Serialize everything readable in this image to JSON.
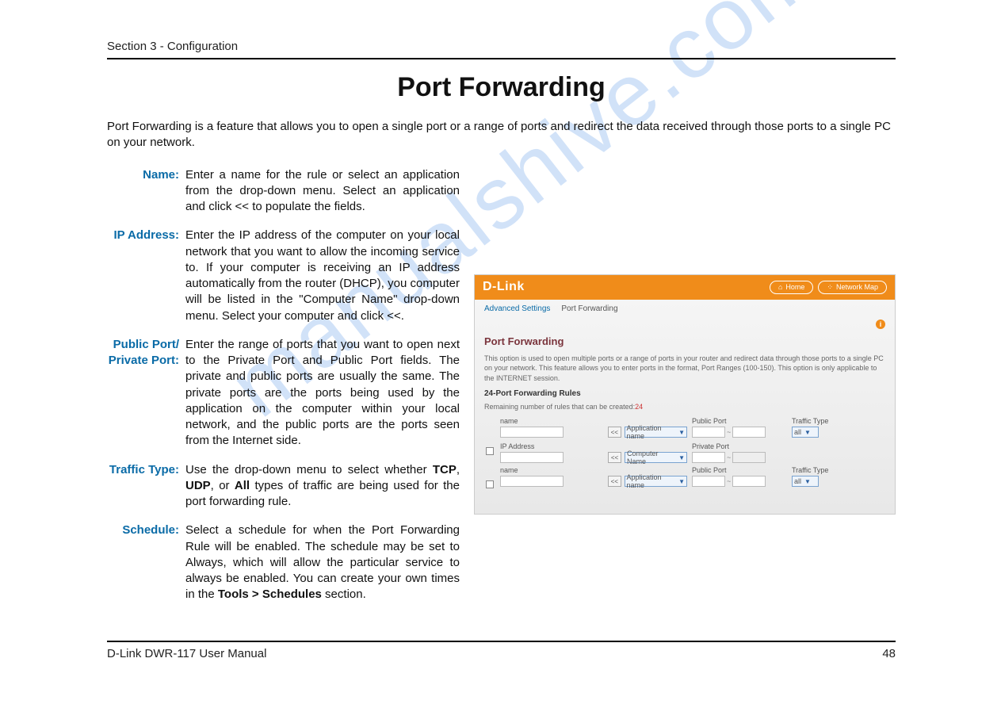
{
  "watermark": "manualshive.com",
  "header": {
    "section_label": "Section 3 - Configuration"
  },
  "title": "Port Forwarding",
  "intro": "Port Forwarding is a feature that allows you to open a single port or a range of ports and redirect the data received through those ports to a single PC on your network.",
  "definitions": [
    {
      "label": "Name:",
      "desc": "Enter a name for the rule or select an application from the drop-down menu. Select an application and click << to populate the fields."
    },
    {
      "label": "IP Address:",
      "desc": "Enter the IP address of the computer on your local network that you want to allow the incoming service to. If your computer is receiving an IP address automatically from the router (DHCP), you computer will be listed in the \"Computer Name\" drop-down menu. Select your computer and click <<."
    },
    {
      "label": "Public Port/",
      "label2": "Private Port:",
      "desc": "Enter the range of ports that you want to open next to the Private Port and Public Port fields. The private and public ports are usually the same. The private ports are the ports being used by the application on the computer within your local network, and the public ports are the ports seen from the Internet side."
    },
    {
      "label": "Traffic Type:",
      "desc_pre": "Use the drop-down menu to select whether ",
      "desc_bold1": "TCP",
      "desc_mid1": ", ",
      "desc_bold2": "UDP",
      "desc_mid2": ", or ",
      "desc_bold3": "All",
      "desc_post": " types of traffic are being used for the port forwarding rule."
    },
    {
      "label": "Schedule:",
      "desc_pre": "Select a schedule for when the Port Forwarding Rule will be enabled. The schedule may be set to Always, which will allow the particular service to always be enabled. You can create your own times in the ",
      "desc_bold1": "Tools > Schedules",
      "desc_post": " section."
    }
  ],
  "shot": {
    "logo": "D-Link",
    "home_btn": "Home",
    "netmap_btn": "Network Map",
    "bc1": "Advanced Settings",
    "bc2": "Port Forwarding",
    "h": "Port Forwarding",
    "desc": "This option is used to open multiple ports or a range of ports in your router and redirect data through those ports to a single PC on your network. This feature allows you to enter ports in the format, Port Ranges (100-150). This option is only applicable to the INTERNET session.",
    "sub": "24-Port Forwarding Rules",
    "remaining_pre": "Remaining number of rules that can be created:",
    "remaining_num": "24",
    "labels": {
      "name": "name",
      "ip": "IP Address",
      "pubport": "Public Port",
      "privport": "Private Port",
      "traffic": "Traffic Type",
      "appname": "Application name",
      "compname": "Computer Name",
      "all": "all"
    }
  },
  "footer": {
    "left": "D-Link DWR-117 User Manual",
    "right": "48"
  }
}
